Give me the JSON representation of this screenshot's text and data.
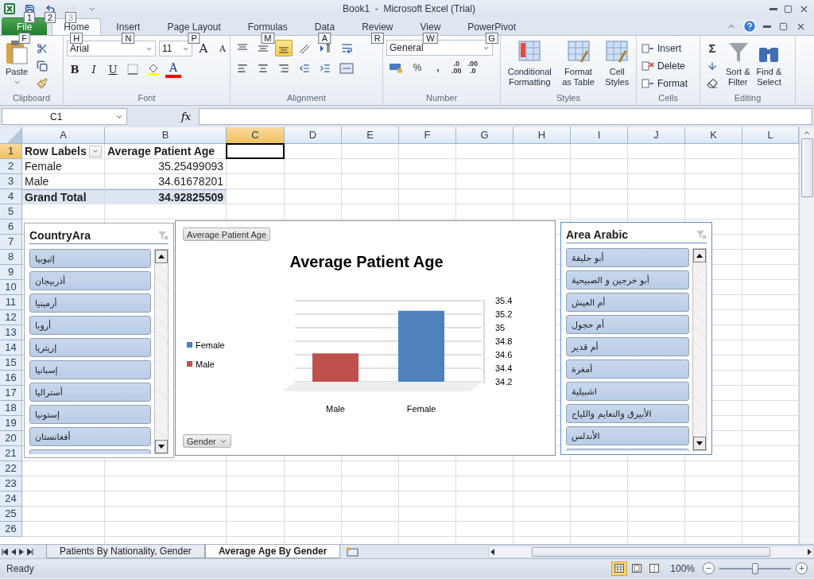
{
  "window": {
    "title": "Book1  -  Microsoft Excel (Trial)"
  },
  "quick_access": [
    {
      "kind": "save",
      "keytip": "1",
      "disabled": false
    },
    {
      "kind": "undo",
      "keytip": "2",
      "disabled": false
    },
    {
      "kind": "redo",
      "keytip": "3",
      "disabled": true
    }
  ],
  "tabs": [
    {
      "label": "File",
      "keytip": "F",
      "kind": "file",
      "selected": false
    },
    {
      "label": "Home",
      "keytip": "H",
      "kind": "tab",
      "selected": true
    },
    {
      "label": "Insert",
      "keytip": "N",
      "kind": "tab",
      "selected": false
    },
    {
      "label": "Page Layout",
      "keytip": "P",
      "kind": "tab",
      "selected": false
    },
    {
      "label": "Formulas",
      "keytip": "M",
      "kind": "tab",
      "selected": false
    },
    {
      "label": "Data",
      "keytip": "A",
      "kind": "tab",
      "selected": false
    },
    {
      "label": "Review",
      "keytip": "R",
      "kind": "tab",
      "selected": false
    },
    {
      "label": "View",
      "keytip": "W",
      "kind": "tab",
      "selected": false
    },
    {
      "label": "PowerPivot",
      "keytip": "G",
      "kind": "tab",
      "selected": false
    }
  ],
  "ribbon": {
    "clipboard": {
      "label": "Clipboard",
      "paste": "Paste"
    },
    "font": {
      "label": "Font",
      "name": "Arial",
      "size": "11",
      "grow": "A",
      "shrink": "A",
      "bold": "B",
      "italic": "I",
      "underline": "U",
      "font_color_letter": "A"
    },
    "alignment": {
      "label": "Alignment",
      "bottom_align_selected": true
    },
    "number": {
      "label": "Number",
      "format": "General",
      "percent": "%",
      "comma": ",",
      "increase": ".0\n.00",
      "decrease": ".00\n.0"
    },
    "styles": {
      "label": "Styles",
      "buttons": [
        "Conditional\nFormatting",
        "Format\nas Table",
        "Cell\nStyles"
      ]
    },
    "cells": {
      "label": "Cells",
      "buttons": [
        "Insert",
        "Delete",
        "Format"
      ]
    },
    "editing": {
      "label": "Editing",
      "sum": "Σ",
      "buttons": [
        "Sort &\nFilter",
        "Find &\nSelect"
      ]
    }
  },
  "formula_bar": {
    "name_box": "C1",
    "fx": "fx"
  },
  "sheet": {
    "columns": [
      {
        "label": "A",
        "selected": false
      },
      {
        "label": "B",
        "selected": false
      },
      {
        "label": "C",
        "selected": true
      },
      {
        "label": "D",
        "selected": false
      },
      {
        "label": "E",
        "selected": false
      },
      {
        "label": "F",
        "selected": false
      },
      {
        "label": "G",
        "selected": false
      },
      {
        "label": "H",
        "selected": false
      },
      {
        "label": "I",
        "selected": false
      },
      {
        "label": "J",
        "selected": false
      },
      {
        "label": "K",
        "selected": false
      },
      {
        "label": "L",
        "selected": false
      }
    ],
    "rows": [
      {
        "label": "1",
        "selected": true
      },
      {
        "label": "2",
        "selected": false
      },
      {
        "label": "3",
        "selected": false
      },
      {
        "label": "4",
        "selected": false
      },
      {
        "label": "5",
        "selected": false
      },
      {
        "label": "6",
        "selected": false
      },
      {
        "label": "7",
        "selected": false
      },
      {
        "label": "8",
        "selected": false
      },
      {
        "label": "9",
        "selected": false
      },
      {
        "label": "10",
        "selected": false
      },
      {
        "label": "11",
        "selected": false
      },
      {
        "label": "12",
        "selected": false
      },
      {
        "label": "13",
        "selected": false
      },
      {
        "label": "14",
        "selected": false
      },
      {
        "label": "15",
        "selected": false
      },
      {
        "label": "16",
        "selected": false
      },
      {
        "label": "17",
        "selected": false
      },
      {
        "label": "18",
        "selected": false
      },
      {
        "label": "19",
        "selected": false
      },
      {
        "label": "20",
        "selected": false
      },
      {
        "label": "21",
        "selected": false
      },
      {
        "label": "22",
        "selected": false
      },
      {
        "label": "23",
        "selected": false
      },
      {
        "label": "24",
        "selected": false
      },
      {
        "label": "25",
        "selected": false
      },
      {
        "label": "26",
        "selected": false
      }
    ]
  },
  "pivot": {
    "rows": [
      {
        "kind": "header",
        "cells": [
          "Row Labels",
          "Average Patient Age"
        ]
      },
      {
        "kind": "data",
        "cells": [
          "Female",
          "35.25499093"
        ]
      },
      {
        "kind": "data",
        "cells": [
          "Male",
          "34.61678201"
        ]
      },
      {
        "kind": "total",
        "cells": [
          "Grand Total",
          "34.92825509"
        ]
      }
    ]
  },
  "country_slicer": {
    "title": "CountryAra",
    "selected": false,
    "items": [
      "إثيوبيا",
      "أذربيجان",
      "أرمينيا",
      "أروبا",
      "إريتريا",
      "إسبانيا",
      "أستراليا",
      "إستونيا",
      "أفغانستان"
    ]
  },
  "chart": {
    "axis_button": "Gender",
    "legend": [
      {
        "label": "Female",
        "color": "#4f81bd"
      },
      {
        "label": "Male",
        "color": "#c0504d"
      }
    ],
    "chart_data": {
      "type": "bar",
      "title": "Average Patient Age",
      "categories": [
        "Male",
        "Female"
      ],
      "series": [
        {
          "name": "Average Patient Age",
          "values": [
            34.62,
            35.25
          ]
        }
      ],
      "grid": true,
      "ylim": [
        34.2,
        35.4
      ],
      "yticks": [
        34.2,
        34.4,
        34.6,
        34.8,
        35,
        35.2,
        35.4
      ]
    }
  },
  "area_slicer": {
    "title": "Area Arabic",
    "selected": true,
    "items": [
      "أبو حليفة",
      "أبو خرجين و الصبيحية",
      "أم العيش",
      "أم حجول",
      "أم قدير",
      "أمغرة",
      "اشبيلية",
      "الأبيرق والنعايم واللياح",
      "الأندلس"
    ]
  },
  "sheet_tabs": [
    {
      "label": "Patients By Nationality, Gender",
      "selected": false
    },
    {
      "label": "Average Age By Gender",
      "selected": true
    }
  ],
  "status_bar": {
    "status": "Ready",
    "views": [
      {
        "kind": "normal",
        "selected": true
      },
      {
        "kind": "layout",
        "selected": false
      },
      {
        "kind": "break",
        "selected": false
      }
    ],
    "zoom": "100%",
    "zoom_level": {
      "level": 0.5
    }
  }
}
